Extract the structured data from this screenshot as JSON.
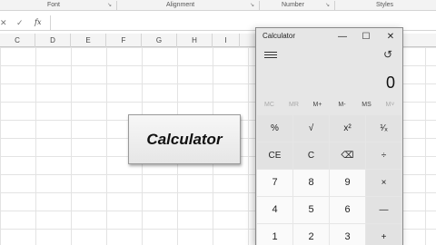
{
  "ribbon": {
    "groups": [
      {
        "label": "Font"
      },
      {
        "label": "Alignment"
      },
      {
        "label": "Number"
      },
      {
        "label": "Styles"
      }
    ],
    "launcher_glyph": "↘"
  },
  "formula_bar": {
    "cancel": "✕",
    "enter": "✓",
    "fx": "fx",
    "value": ""
  },
  "columns": [
    "C",
    "D",
    "E",
    "F",
    "G",
    "H",
    "I"
  ],
  "shape": {
    "label": "Calculator"
  },
  "calculator": {
    "title": "Calculator",
    "window_buttons": {
      "minimize": "—",
      "maximize": "☐",
      "close": "✕"
    },
    "display": "0",
    "memory": [
      {
        "label": "MC",
        "enabled": false
      },
      {
        "label": "MR",
        "enabled": false
      },
      {
        "label": "M+",
        "enabled": true
      },
      {
        "label": "M-",
        "enabled": true
      },
      {
        "label": "MS",
        "enabled": true
      },
      {
        "label": "M˅",
        "enabled": false
      }
    ],
    "rows": [
      [
        "%",
        "√",
        "x²",
        "¹⁄ₓ"
      ],
      [
        "CE",
        "C",
        "⌫",
        "÷"
      ],
      [
        "7",
        "8",
        "9",
        "×"
      ],
      [
        "4",
        "5",
        "6",
        "—"
      ],
      [
        "1",
        "2",
        "3",
        "+"
      ]
    ]
  }
}
